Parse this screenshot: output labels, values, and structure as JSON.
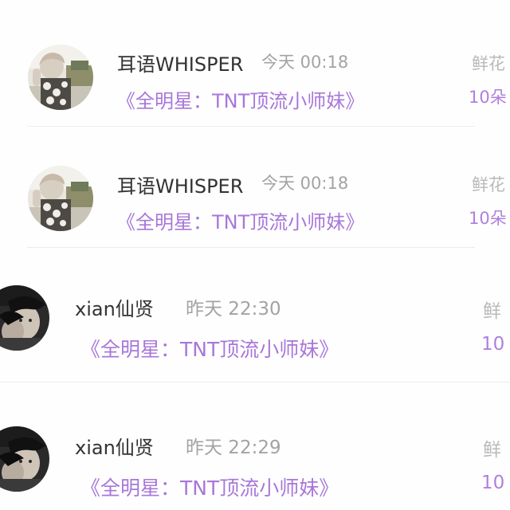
{
  "comments": [
    {
      "user": "耳语WHISPER",
      "time": "今天 00:18",
      "book": "《全明星：TNT顶流小师妹》",
      "gift_label": "鲜花",
      "gift_count": "10朵",
      "avatar": "user-photo-light"
    },
    {
      "user": "耳语WHISPER",
      "time": "今天 00:18",
      "book": "《全明星：TNT顶流小师妹》",
      "gift_label": "鲜花",
      "gift_count": "10朵",
      "avatar": "user-photo-light"
    },
    {
      "user": "xian仙贤",
      "time": "昨天 22:30",
      "book": "《全明星：TNT顶流小师妹》",
      "gift_label": "鲜",
      "gift_count": "10",
      "avatar": "user-photo-dark"
    },
    {
      "user": "xian仙贤",
      "time": "昨天 22:29",
      "book": "《全明星：TNT顶流小师妹》",
      "gift_label": "鲜",
      "gift_count": "10",
      "avatar": "user-photo-dark"
    }
  ],
  "colors": {
    "username": "#333333",
    "time": "#a3a3a3",
    "book": "#a877d9",
    "gift_label": "#b9b9b9",
    "gift_count": "#b07fdf"
  }
}
